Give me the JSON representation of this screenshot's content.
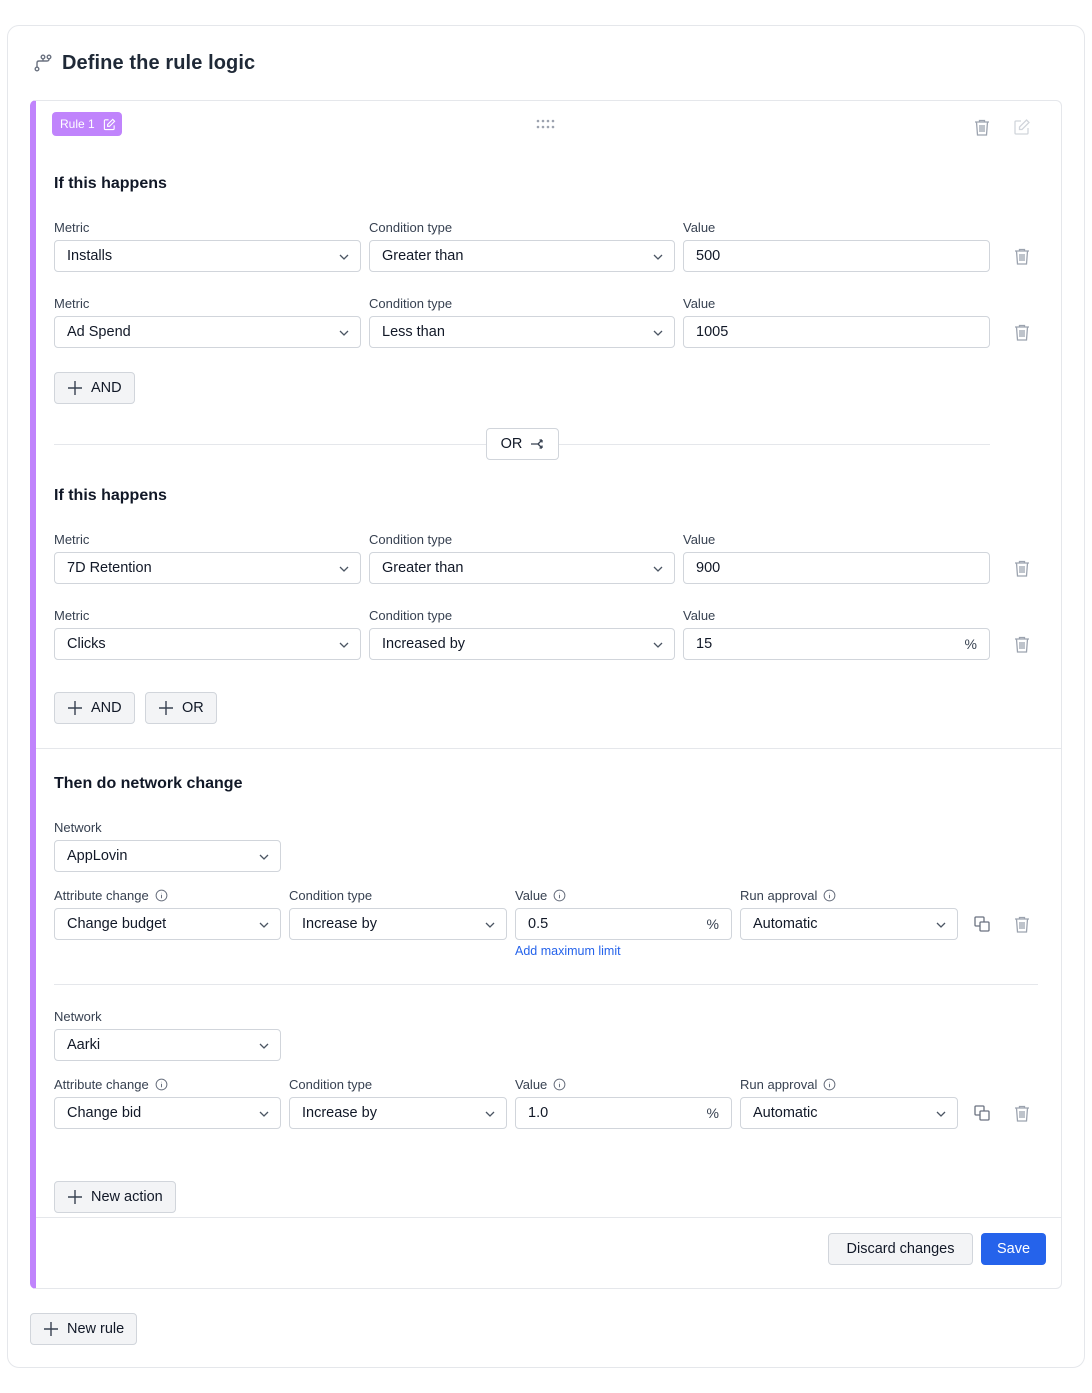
{
  "page": {
    "title": "Define the rule logic"
  },
  "rule": {
    "badge": "Rule 1"
  },
  "group1": {
    "title": "If this happens",
    "rows": [
      {
        "metric_label": "Metric",
        "metric": "Installs",
        "condition_label": "Condition type",
        "condition": "Greater than",
        "value_label": "Value",
        "value": "500"
      },
      {
        "metric_label": "Metric",
        "metric": "Ad Spend",
        "condition_label": "Condition type",
        "condition": "Less than",
        "value_label": "Value",
        "value": "1005"
      }
    ],
    "and_label": "AND"
  },
  "or_divider": {
    "label": "OR"
  },
  "group2": {
    "title": "If this happens",
    "rows": [
      {
        "metric_label": "Metric",
        "metric": "7D Retention",
        "condition_label": "Condition type",
        "condition": "Greater than",
        "value_label": "Value",
        "value": "900"
      },
      {
        "metric_label": "Metric",
        "metric": "Clicks",
        "condition_label": "Condition type",
        "condition": "Increased by",
        "value_label": "Value",
        "value": "15",
        "unit": "%"
      }
    ],
    "and_label": "AND",
    "or_label": "OR"
  },
  "actions": {
    "title": "Then do network change",
    "items": [
      {
        "network_label": "Network",
        "network": "AppLovin",
        "attribute_label": "Attribute change",
        "attribute": "Change budget",
        "condition_label": "Condition type",
        "condition": "Increase by",
        "value_label": "Value",
        "value": "0.5",
        "unit": "%",
        "approval_label": "Run approval",
        "approval": "Automatic",
        "max_limit_link": "Add maximum limit"
      },
      {
        "network_label": "Network",
        "network": "Aarki",
        "attribute_label": "Attribute change",
        "attribute": "Change bid",
        "condition_label": "Condition type",
        "condition": "Increase by",
        "value_label": "Value",
        "value": "1.0",
        "unit": "%",
        "approval_label": "Run approval",
        "approval": "Automatic"
      }
    ],
    "new_action_label": "New action"
  },
  "footer": {
    "discard_label": "Discard changes",
    "save_label": "Save"
  },
  "new_rule_label": "New rule",
  "colors": {
    "accent": "#c084fc",
    "primary": "#2563eb",
    "border": "#d1d5db"
  }
}
